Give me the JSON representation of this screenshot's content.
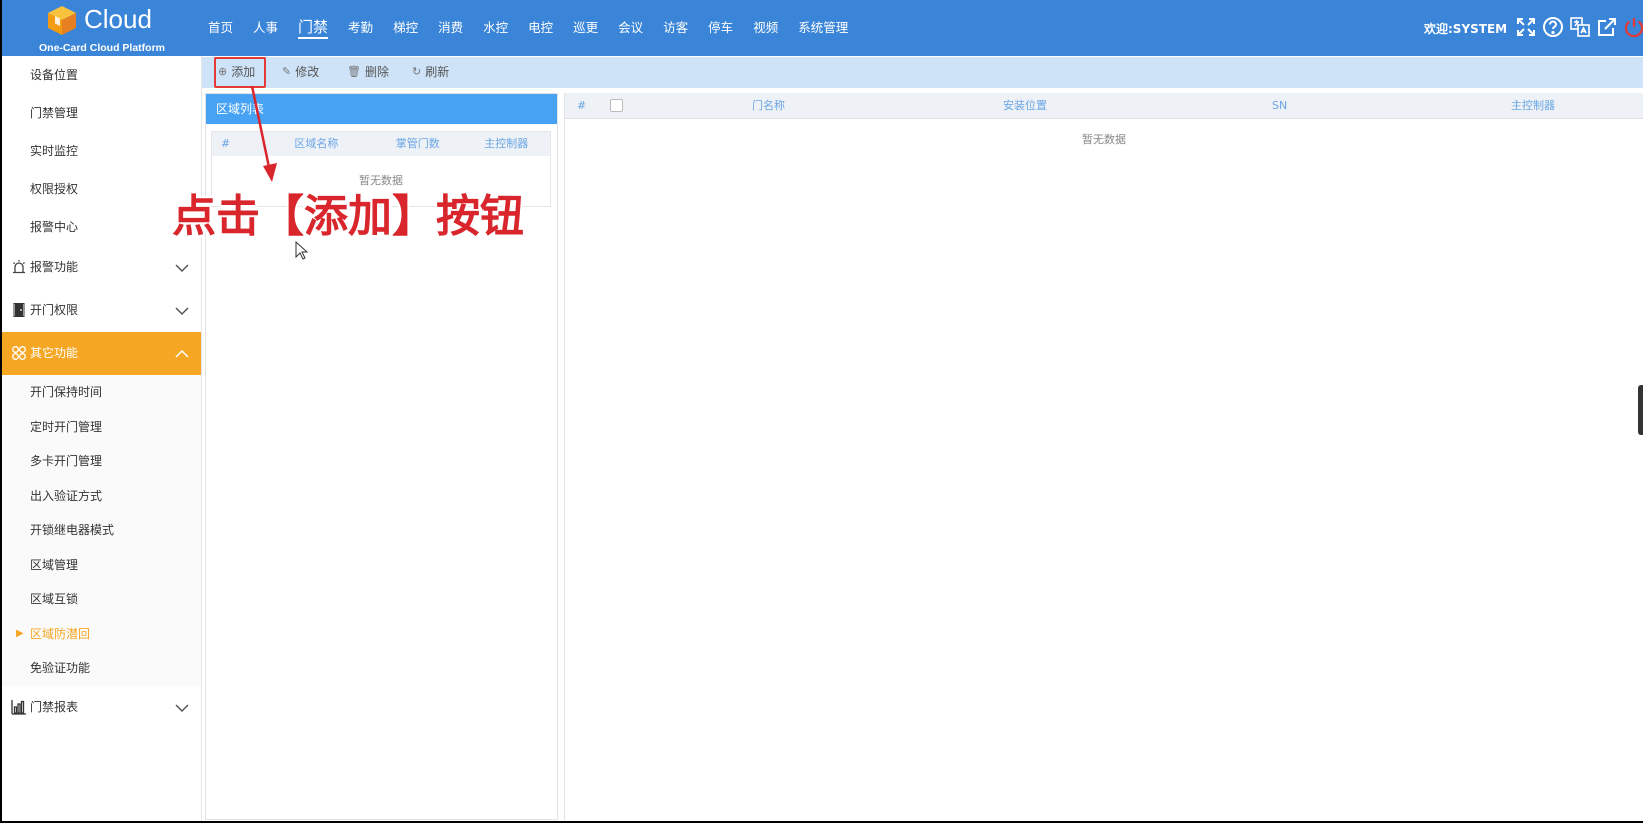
{
  "header": {
    "logo_text": "Cloud",
    "logo_sub": "One-Card Cloud Platform",
    "nav": [
      "首页",
      "人事",
      "门禁",
      "考勤",
      "梯控",
      "消费",
      "水控",
      "电控",
      "巡更",
      "会议",
      "访客",
      "停车",
      "视频",
      "系统管理"
    ],
    "active_nav": "门禁",
    "welcome": "欢迎:SYSTEM",
    "icons": [
      "fullscreen-icon",
      "help-icon",
      "translate-icon",
      "external-link-icon",
      "power-icon"
    ]
  },
  "sidebar": {
    "top_items": [
      "设备位置",
      "门禁管理",
      "实时监控",
      "权限授权",
      "报警中心"
    ],
    "groups": {
      "alarm": "报警功能",
      "door_auth": "开门权限",
      "other": "其它功能",
      "report": "门禁报表"
    },
    "other_items": [
      "开门保持时间",
      "定时开门管理",
      "多卡开门管理",
      "出入验证方式",
      "开锁继电器模式",
      "区域管理",
      "区域互锁",
      "区域防潜回",
      "免验证功能"
    ],
    "current_item": "区域防潜回"
  },
  "toolbar": {
    "add": "添加",
    "edit": "修改",
    "delete": "删除",
    "refresh": "刷新"
  },
  "area_panel": {
    "title": "区域列表",
    "columns": [
      "#",
      "区域名称",
      "掌管门数",
      "主控制器"
    ],
    "empty": "暂无数据"
  },
  "door_panel": {
    "columns": [
      "#",
      "门名称",
      "安装位置",
      "SN",
      "主控制器"
    ],
    "empty": "暂无数据"
  },
  "annotation": {
    "text": "点击【添加】按钮"
  },
  "colors": {
    "header_bg": "#3a85d8",
    "active_group": "#f5a623",
    "panel_head": "#47a2f3",
    "annotation": "#d8262c"
  }
}
